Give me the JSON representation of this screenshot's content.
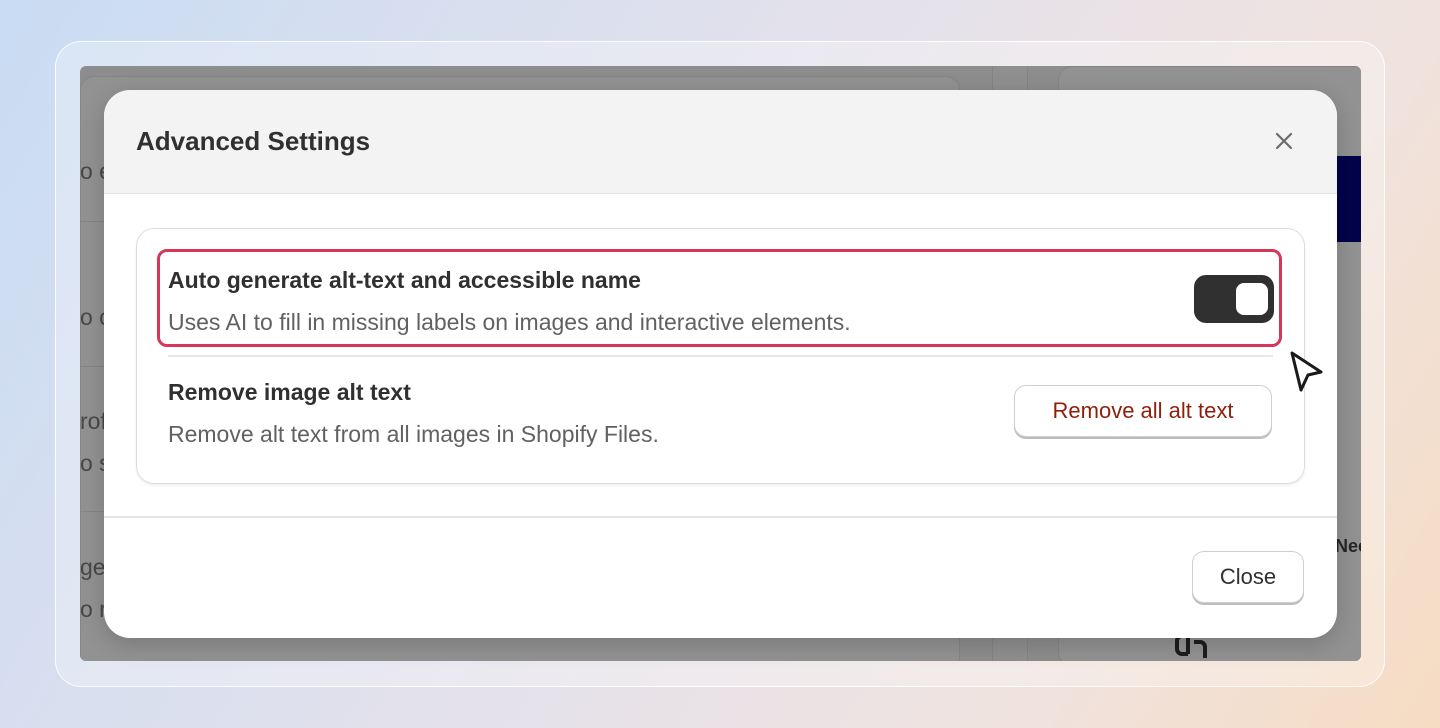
{
  "background_fragments": {
    "left": [
      "o e",
      "o c",
      "rof",
      "o s",
      "ge",
      "o r"
    ],
    "right": "Nee"
  },
  "modal": {
    "title": "Advanced Settings",
    "close_icon": "close-icon"
  },
  "settings": {
    "auto_alt": {
      "title": "Auto generate alt-text and accessible name",
      "description": "Uses AI to fill in missing labels on images and interactive elements.",
      "enabled": true
    },
    "remove_alt": {
      "title": "Remove image alt text",
      "description": "Remove alt text from all images in Shopify Files.",
      "button_label": "Remove all alt text"
    }
  },
  "footer": {
    "close_label": "Close"
  },
  "colors": {
    "highlight": "#d6365a",
    "toggle_on": "#303030",
    "danger_text": "#8e1f0b"
  }
}
